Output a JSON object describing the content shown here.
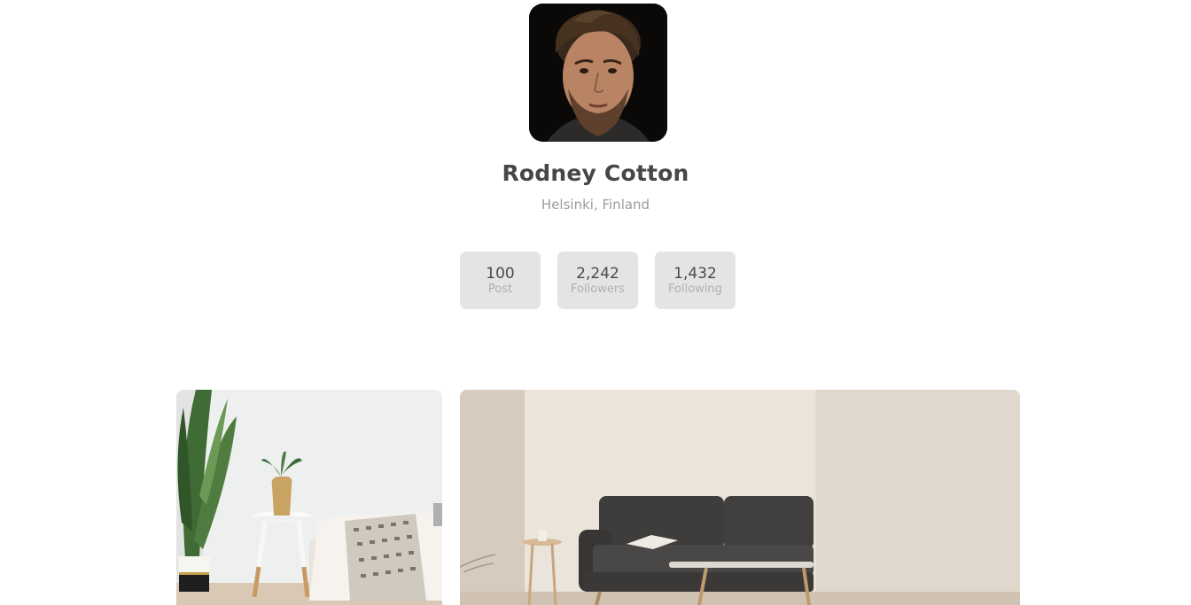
{
  "profile": {
    "name": "Rodney Cotton",
    "location": "Helsinki, Finland"
  },
  "stats": [
    {
      "value": "100",
      "label": "Post"
    },
    {
      "value": "2,242",
      "label": "Followers"
    },
    {
      "value": "1,432",
      "label": "Following"
    }
  ],
  "gallery": [
    {
      "subject": "living room with plant, side table and blanket"
    },
    {
      "subject": "living room with dark grey sofa and coffee table"
    }
  ]
}
